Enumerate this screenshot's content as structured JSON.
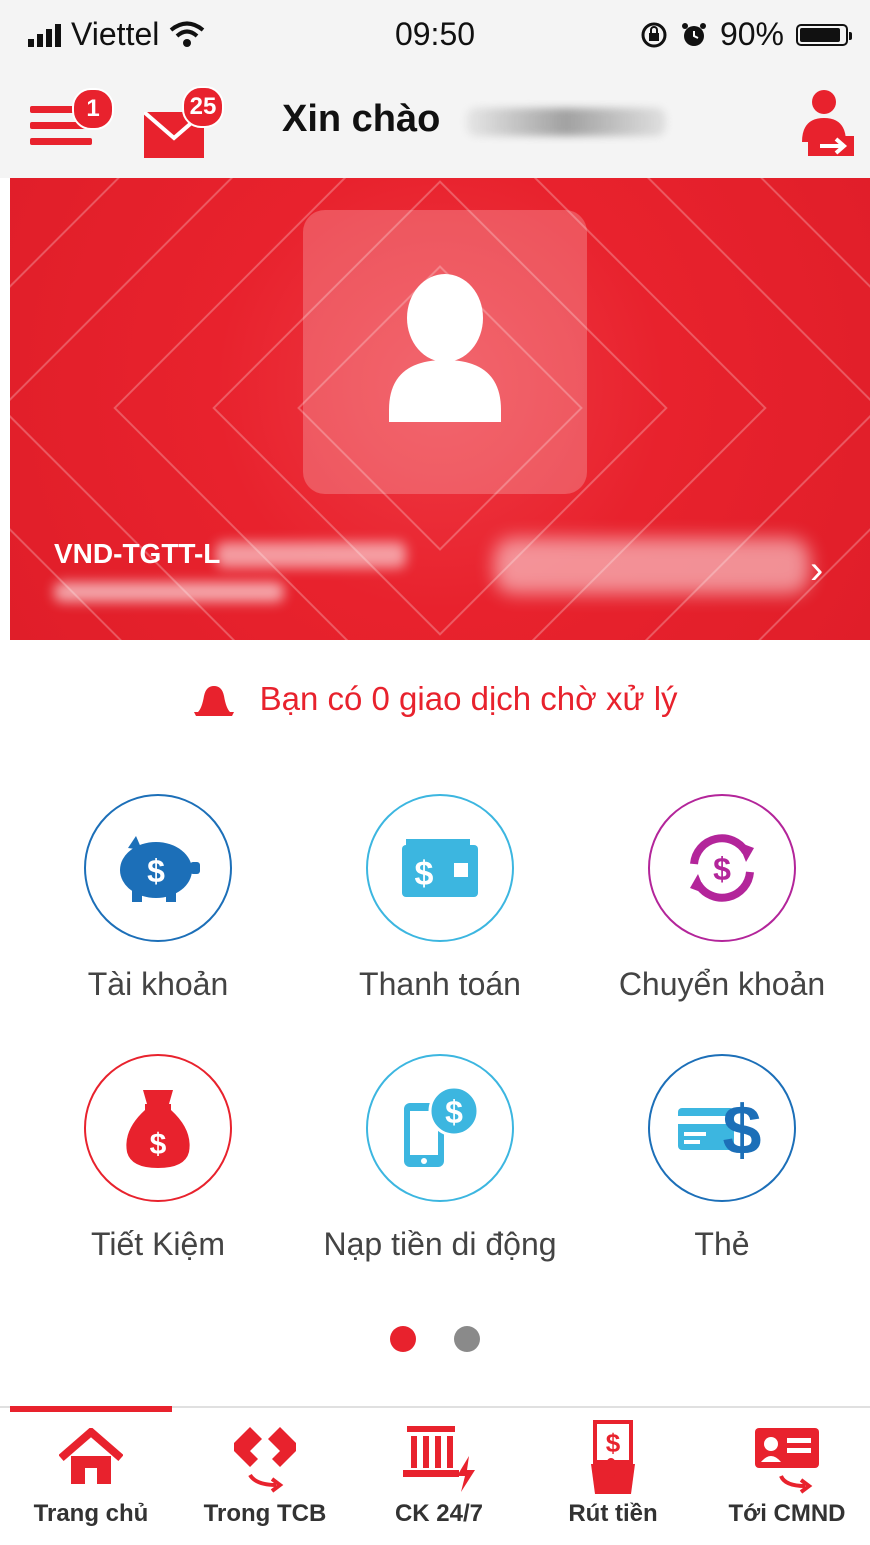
{
  "status_bar": {
    "carrier": "Viettel",
    "time": "09:50",
    "battery": "90%",
    "battery_level": 0.9
  },
  "header": {
    "menu_badge": "1",
    "mail_badge": "25",
    "greeting": "Xin chào"
  },
  "account": {
    "name_prefix": "VND-TGTT-L"
  },
  "pending": {
    "text": "Bạn có 0 giao dịch chờ xử lý"
  },
  "services": [
    {
      "label": "Tài khoản",
      "icon": "piggy-bank-icon",
      "color": "#1c6fb8"
    },
    {
      "label": "Thanh toán",
      "icon": "wallet-icon",
      "color": "#3cb6e0"
    },
    {
      "label": "Chuyển khoản",
      "icon": "exchange-icon",
      "color": "#b3259a"
    },
    {
      "label": "Tiết Kiệm",
      "icon": "money-bag-icon",
      "color": "#e8222d"
    },
    {
      "label": "Nạp tiền di động",
      "icon": "mobile-topup-icon",
      "color": "#3cb6e0"
    },
    {
      "label": "Thẻ",
      "icon": "card-icon",
      "color": "#1c6fb8"
    }
  ],
  "pagination": {
    "pages": 2,
    "active": 1
  },
  "tabs": [
    {
      "label": "Trang chủ",
      "icon": "home-icon"
    },
    {
      "label": "Trong TCB",
      "icon": "transfer-tcb-icon"
    },
    {
      "label": "CK 24/7",
      "icon": "bank-247-icon"
    },
    {
      "label": "Rút tiền",
      "icon": "withdraw-icon"
    },
    {
      "label": "Tới CMND",
      "icon": "id-card-icon"
    }
  ],
  "colors": {
    "brand_red": "#e8222d",
    "blue": "#1c6fb8",
    "light_blue": "#3cb6e0",
    "purple": "#b3259a",
    "dot_inactive": "#8a8a8a"
  }
}
